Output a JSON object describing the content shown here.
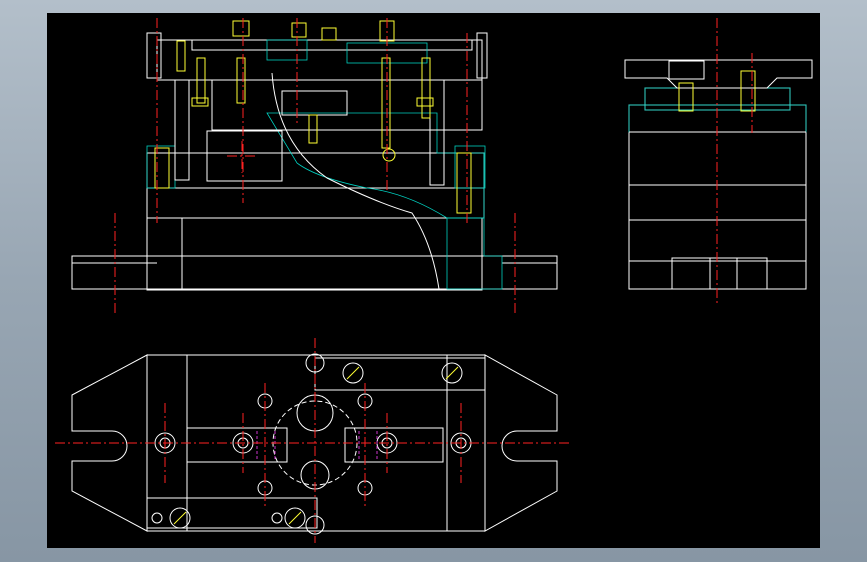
{
  "window": {
    "frame_color": "#9aa8b5",
    "canvas_color": "#000000"
  },
  "drawing": {
    "views": [
      {
        "id": "front-section-view"
      },
      {
        "id": "side-view"
      },
      {
        "id": "top-view"
      }
    ],
    "colors": {
      "outline": "#ffffff",
      "centerline": "#ff2222",
      "hatch": "#00d0c0",
      "fastener": "#ffff33",
      "hidden": "#cc33cc"
    }
  }
}
